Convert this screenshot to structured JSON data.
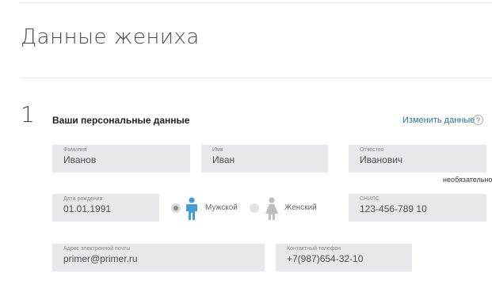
{
  "page_title": "Данные жениха",
  "step_number": "1",
  "section_title": "Ваши персональные данные",
  "edit_link": "Изменить данные",
  "help_icon": "?",
  "fields": {
    "last_name": {
      "label": "Фамилия",
      "value": "Иванов"
    },
    "first_name": {
      "label": "Имя",
      "value": "Иван"
    },
    "patronymic": {
      "label": "Отчество",
      "value": "Иванович"
    },
    "birth_date": {
      "label": "Дата рождения",
      "value": "01.01.1991"
    },
    "snils": {
      "label": "СНИЛС",
      "value": "123-456-789 10"
    },
    "email": {
      "label": "Адрес электронной почты",
      "value": "primer@primer.ru"
    },
    "phone": {
      "label": "Контактный телефон",
      "value": "+7(987)654-32-10"
    }
  },
  "optional_hint": "необязательно",
  "gender": {
    "male_label": "Мужской",
    "female_label": "Женский",
    "selected": "male",
    "male_icon": "male-person-icon",
    "female_icon": "female-person-icon",
    "male_color": "#4a9cd0",
    "female_color": "#bdbdbd"
  }
}
